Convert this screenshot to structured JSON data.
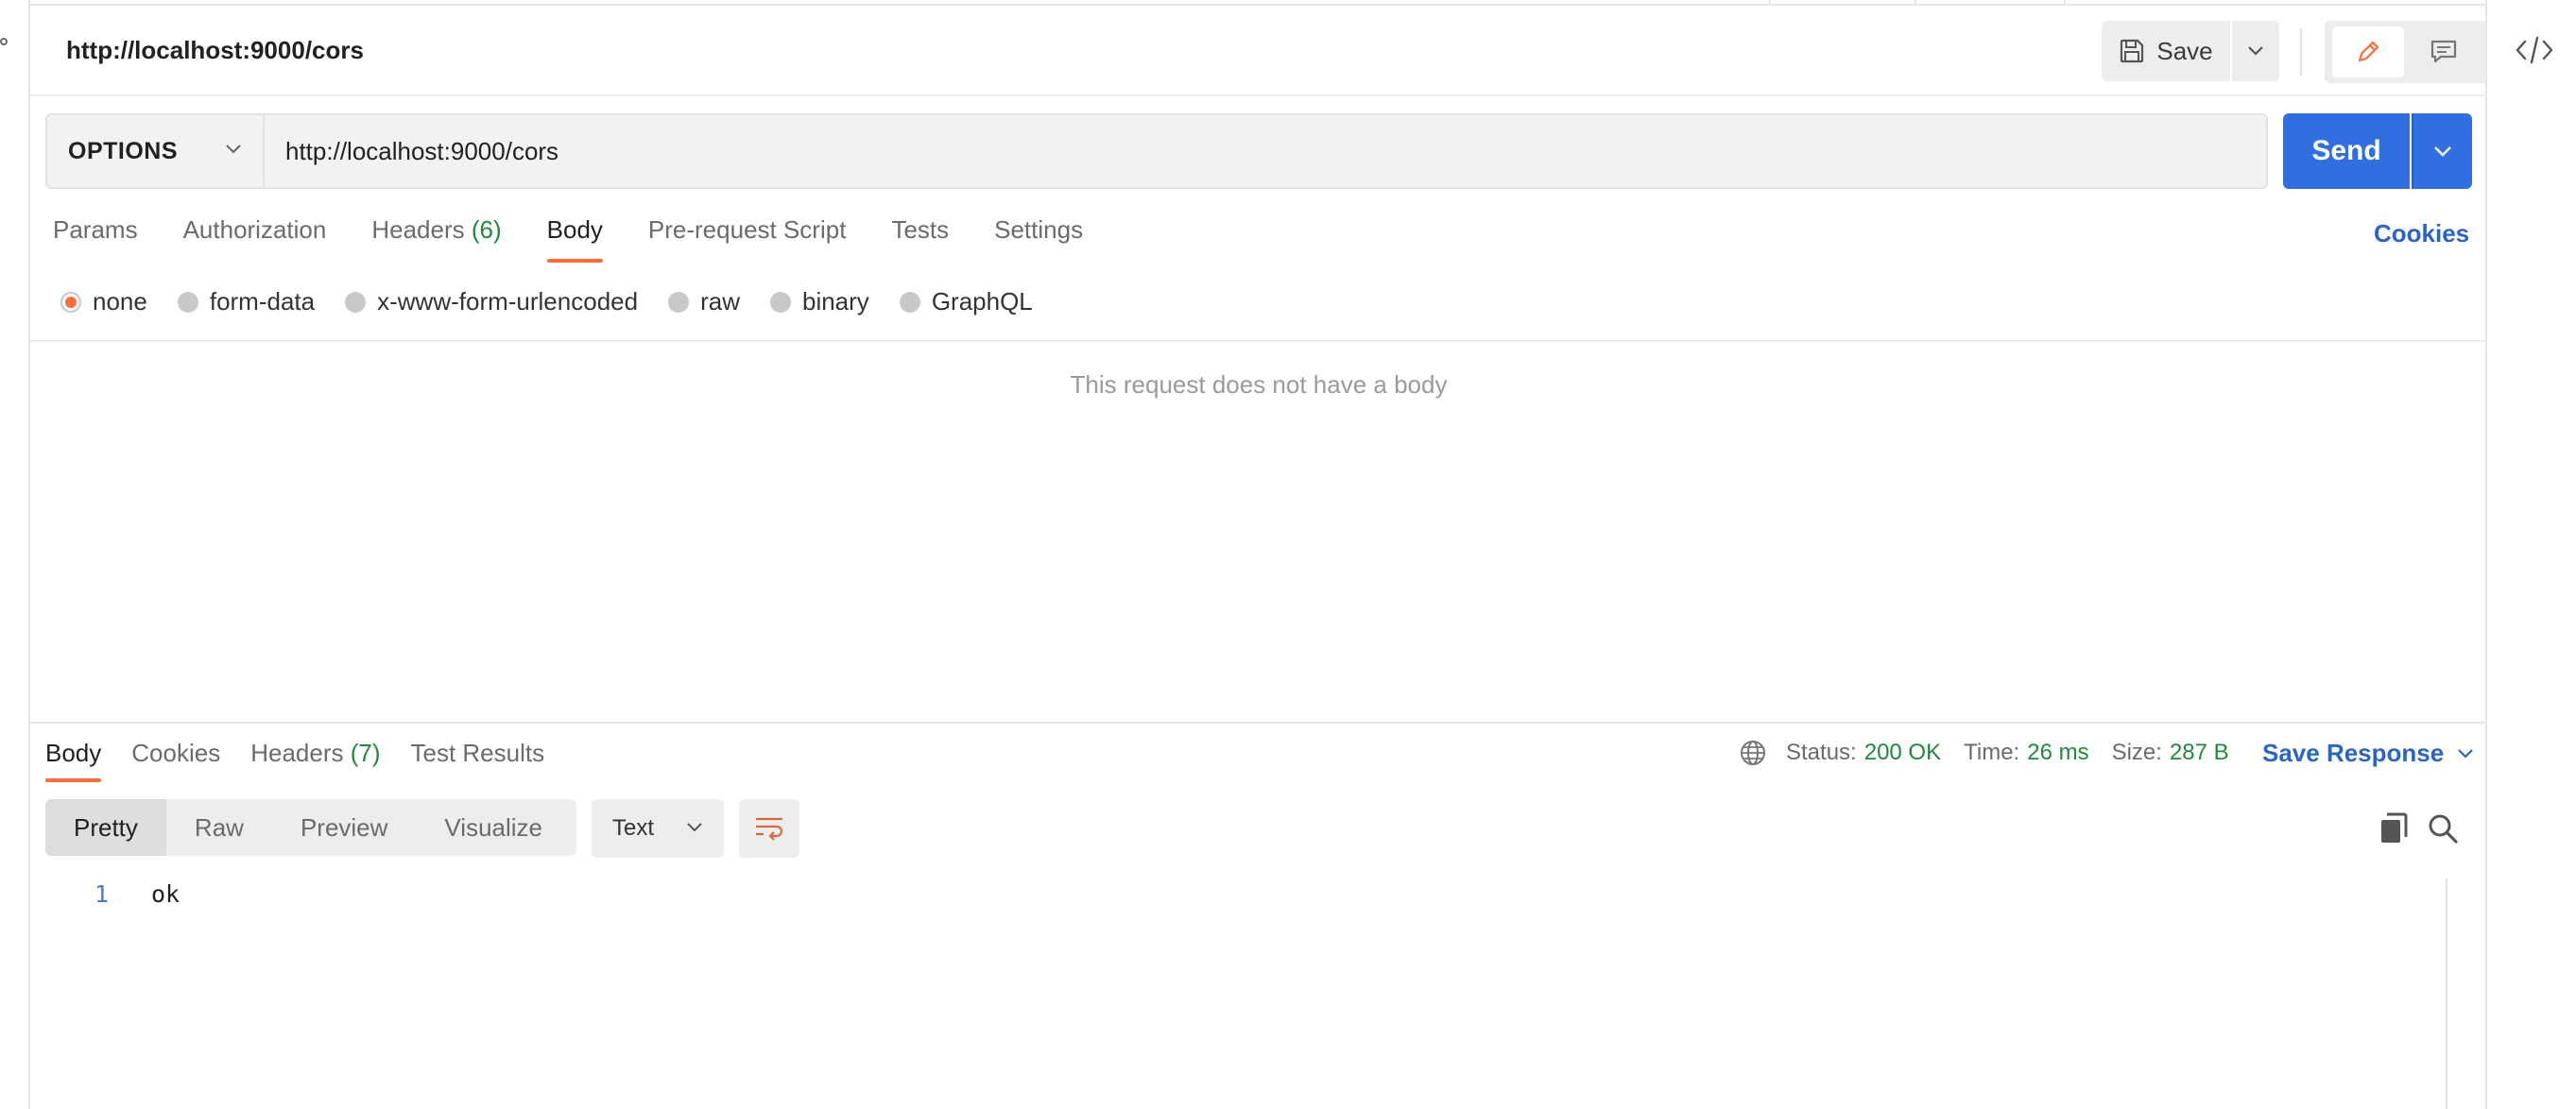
{
  "request": {
    "title": "http://localhost:9000/cors",
    "save_label": "Save",
    "method": "OPTIONS",
    "url": "http://localhost:9000/cors",
    "send_label": "Send"
  },
  "request_tabs": [
    {
      "label": "Params"
    },
    {
      "label": "Authorization"
    },
    {
      "label": "Headers",
      "count": "(6)"
    },
    {
      "label": "Body",
      "active": true
    },
    {
      "label": "Pre-request Script"
    },
    {
      "label": "Tests"
    },
    {
      "label": "Settings"
    }
  ],
  "cookies_label": "Cookies",
  "body_types": [
    {
      "label": "none",
      "checked": true
    },
    {
      "label": "form-data"
    },
    {
      "label": "x-www-form-urlencoded"
    },
    {
      "label": "raw"
    },
    {
      "label": "binary"
    },
    {
      "label": "GraphQL"
    }
  ],
  "no_body_message": "This request does not have a body",
  "response": {
    "tabs": [
      {
        "label": "Body",
        "active": true
      },
      {
        "label": "Cookies"
      },
      {
        "label": "Headers",
        "count": "(7)"
      },
      {
        "label": "Test Results"
      }
    ],
    "status_label": "Status:",
    "status_value": "200 OK",
    "time_label": "Time:",
    "time_value": "26 ms",
    "size_label": "Size:",
    "size_value": "287 B",
    "save_response_label": "Save Response",
    "format_tabs": [
      {
        "label": "Pretty",
        "active": true
      },
      {
        "label": "Raw"
      },
      {
        "label": "Preview"
      },
      {
        "label": "Visualize"
      }
    ],
    "language": "Text",
    "lines": [
      {
        "number": "1",
        "text": "ok"
      }
    ]
  },
  "colors": {
    "accent": "#ff6c37",
    "primary": "#2f6fe0",
    "link": "#2a64c9",
    "success": "#1f8a3b"
  }
}
